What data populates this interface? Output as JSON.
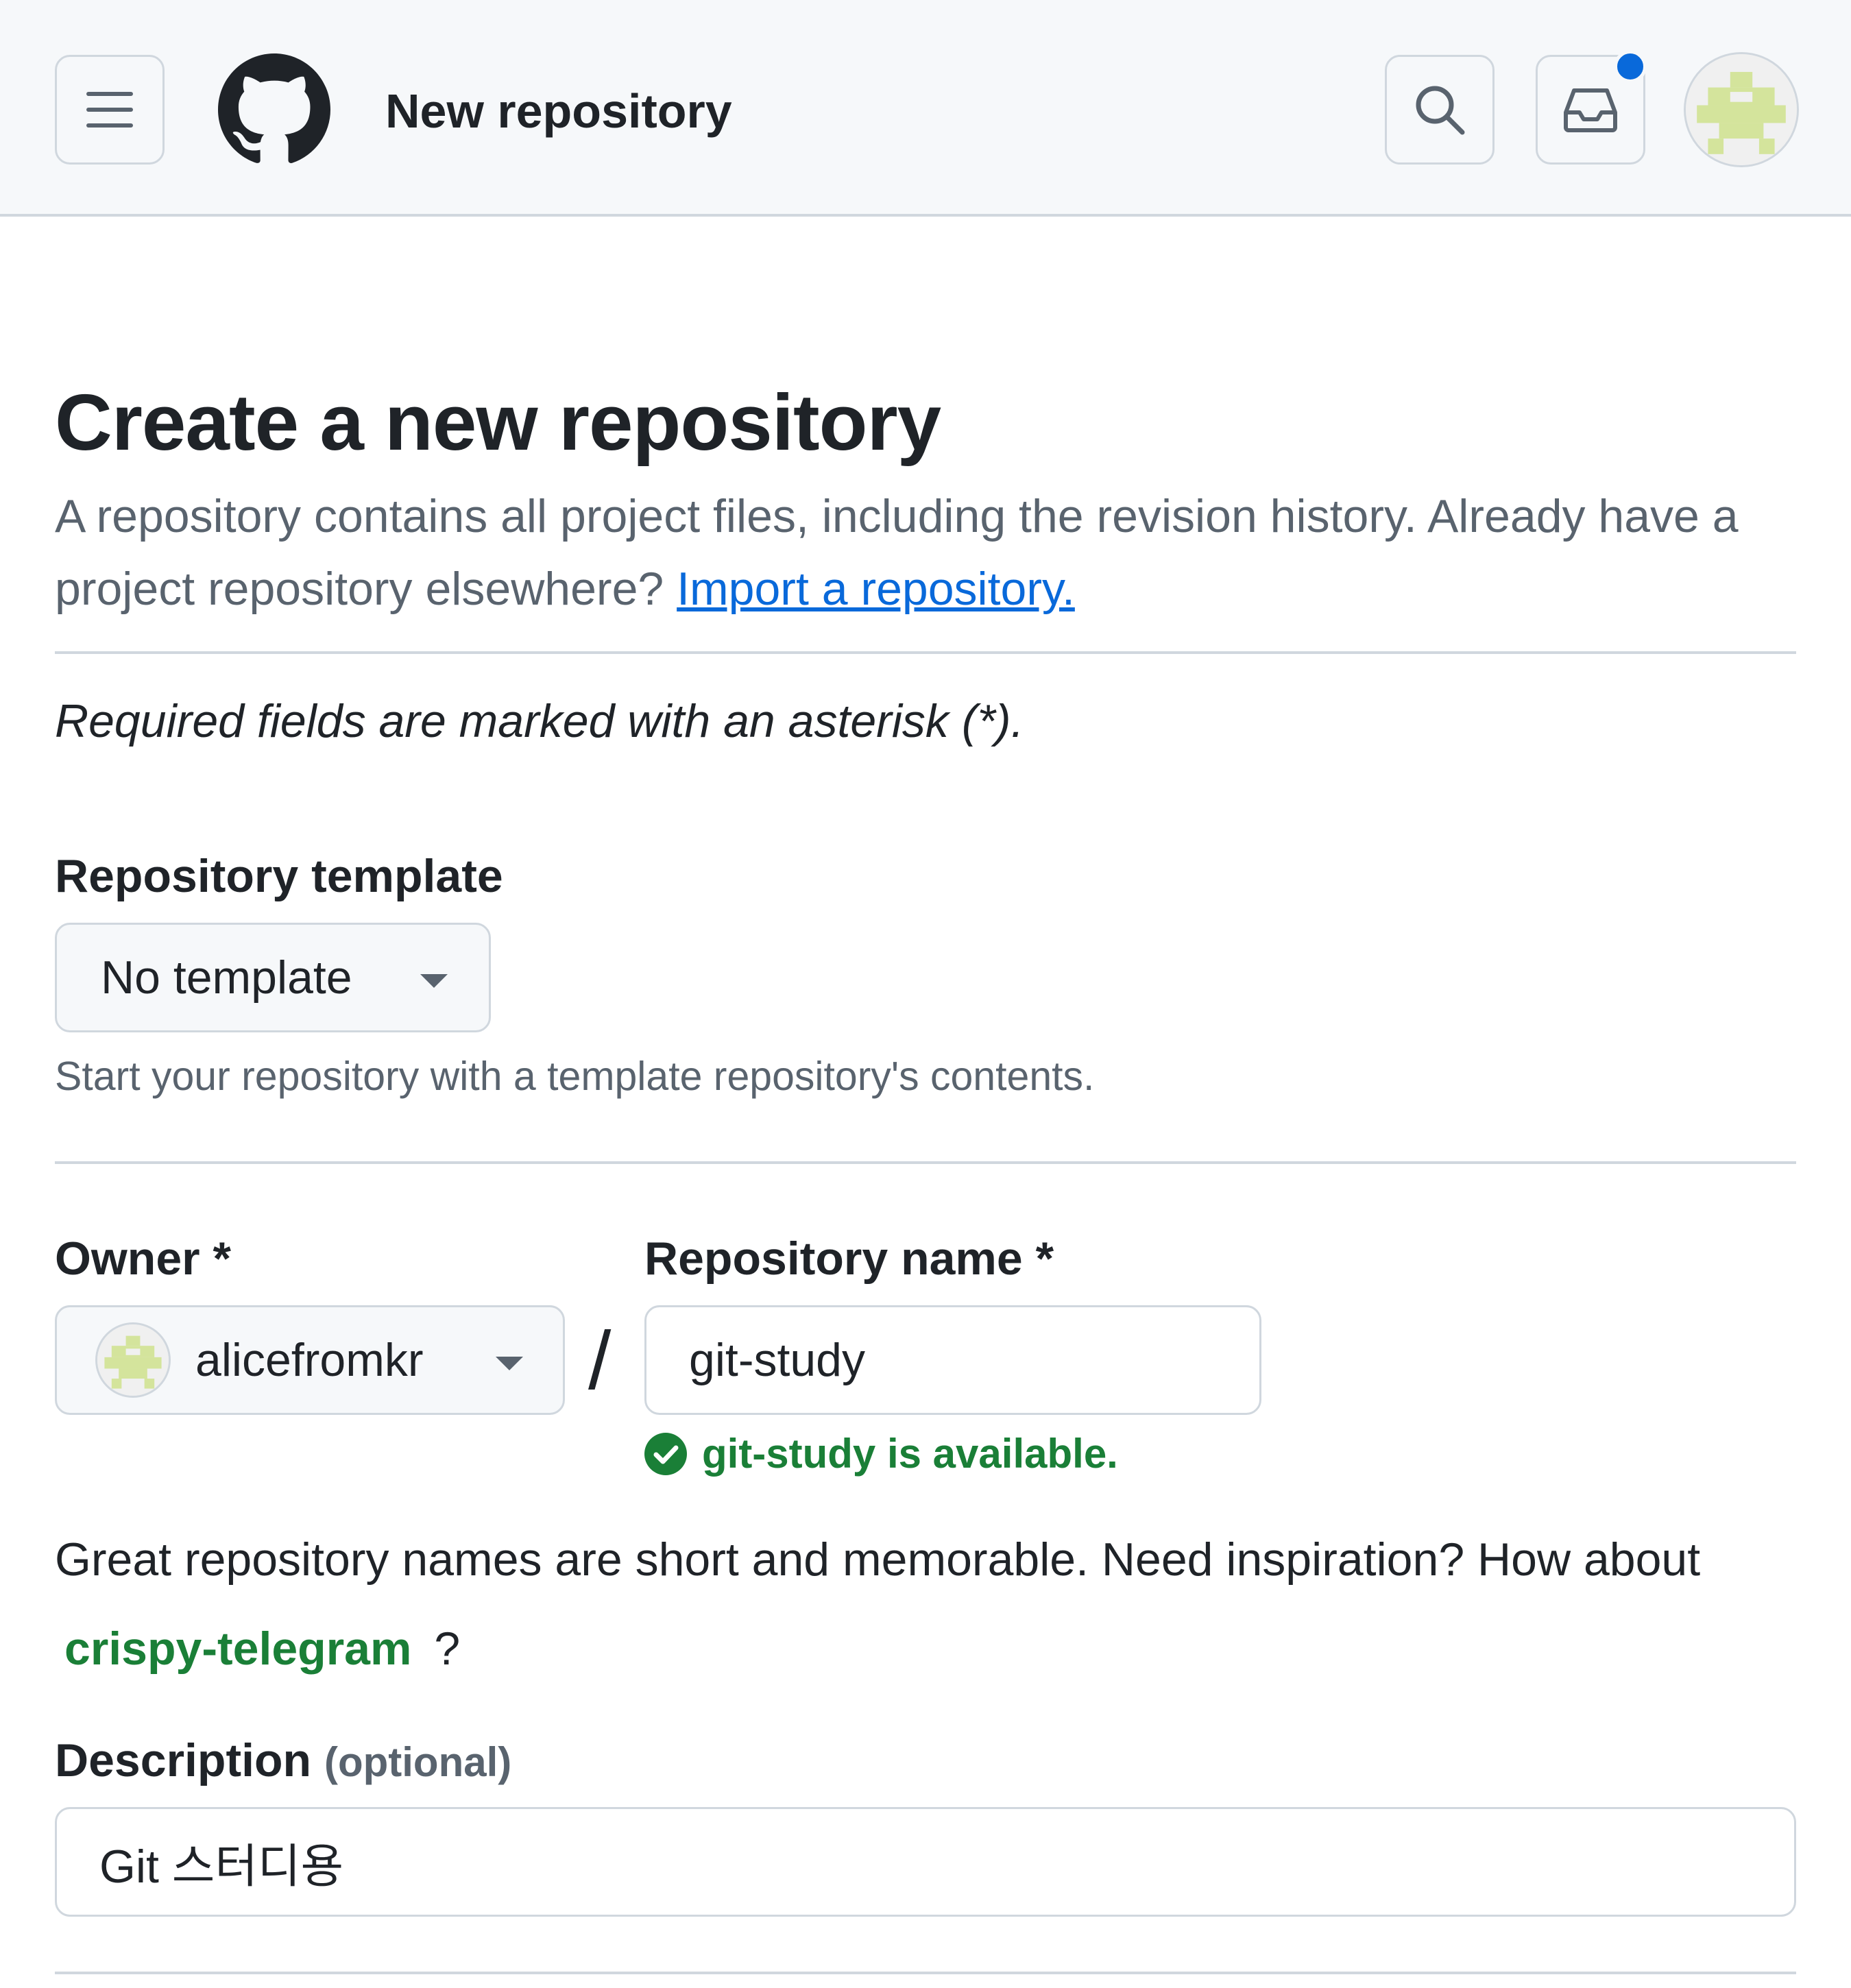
{
  "header": {
    "title": "New repository",
    "menu_icon": "hamburger-menu-icon",
    "logo_icon": "github-octocat-logo",
    "search_icon": "search-icon",
    "inbox_icon": "inbox-icon",
    "notification_dot_color": "#0969da",
    "avatar_icon": "user-avatar-identicon"
  },
  "page": {
    "title": "Create a new repository",
    "intro_text": "A repository contains all project files, including the revision history. Already have a project repository elsewhere?",
    "import_link": "Import a repository.",
    "required_note": "Required fields are marked with an asterisk (*)."
  },
  "template": {
    "label": "Repository template",
    "selected": "No template",
    "helper": "Start your repository with a template repository's contents."
  },
  "owner": {
    "label": "Owner *",
    "selected": "alicefromkr"
  },
  "separator": "/",
  "repo_name": {
    "label": "Repository name *",
    "value": "git-study",
    "availability": "git-study is available."
  },
  "inspiration": {
    "text_before": "Great repository names are short and memorable. Need inspiration? How about",
    "suggestion": "crispy-telegram",
    "text_after": "?"
  },
  "description": {
    "label": "Description",
    "optional": "(optional)",
    "value": "Git 스터디용"
  },
  "colors": {
    "accent_link": "#0969da",
    "success": "#1a7f37",
    "border": "#d0d7de",
    "muted_text": "#59636e",
    "header_bg": "#f6f8fa",
    "avatar_green": "#d4e49c"
  }
}
